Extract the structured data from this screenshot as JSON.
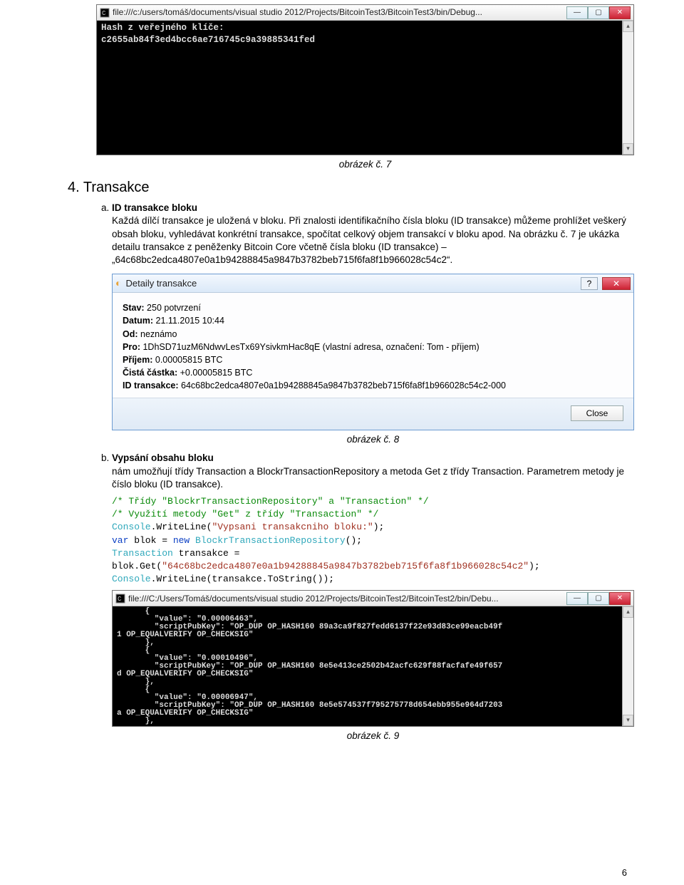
{
  "console1": {
    "path": "file:///c:/users/tomáš/documents/visual studio 2012/Projects/BitcoinTest3/BitcoinTest3/bin/Debug...",
    "line1": "Hash z veřejného klíče:",
    "line2": "c2655ab84f3ed4bcc6ae716745c9a39885341fed"
  },
  "caption7": "obrázek č. 7",
  "section4": {
    "title": "4. Transakce",
    "item_a_title": "ID transakce bloku",
    "item_a_body": "Každá dílčí transakce je uložená v bloku. Při znalosti identifikačního čísla bloku (ID transakce) můžeme prohlížet veškerý obsah bloku, vyhledávat konkrétní transakce, spočítat celkový objem transakcí v bloku apod. Na obrázku č. 7 je ukázka detailu transakce z peněženky Bitcoin Core včetně čísla bloku (ID transakce) – „64c68bc2edca4807e0a1b94288845a9847b3782beb715f6fa8f1b966028c54c2“."
  },
  "dialog": {
    "title": "Detaily transakce",
    "stav_k": "Stav:",
    "stav_v": " 250 potvrzení",
    "datum_k": "Datum:",
    "datum_v": " 21.11.2015 10:44",
    "od_k": "Od:",
    "od_v": " neznámo",
    "pro_k": "Pro:",
    "pro_v": " 1DhSD71uzM6NdwvLesTx69YsivkmHac8qE (vlastní adresa, označení: Tom - příjem)",
    "prijem_k": "Příjem:",
    "prijem_v": " 0.00005815 BTC",
    "cista_k": "Čistá částka:",
    "cista_v": " +0.00005815 BTC",
    "idtx_k": "ID transakce:",
    "idtx_v": " 64c68bc2edca4807e0a1b94288845a9847b3782beb715f6fa8f1b966028c54c2-000",
    "close": "Close"
  },
  "caption8": "obrázek č. 8",
  "item_b": {
    "title": "Vypsání obsahu bloku",
    "body": "nám umožňují třídy Transaction a BlockrTransactionRepository a metoda Get z třídy Transaction. Parametrem metody je číslo bloku (ID transakce)."
  },
  "code": {
    "c1": "/* Třídy \"BlockrTransactionRepository\" a \"Transaction\" */",
    "c2": "/* Využití metody \"Get\" z třídy \"Transaction\" */",
    "l3a": "Console",
    "l3b": ".WriteLine(",
    "l3c": "\"Vypsani transakcniho bloku:\"",
    "l3d": ");",
    "l4a": "var",
    "l4b": " blok = ",
    "l4c": "new",
    "l4d": " ",
    "l4e": "BlockrTransactionRepository",
    "l4f": "();",
    "l5a": "Transaction",
    "l5b": " transakce =",
    "l6a": "blok.Get(",
    "l6b": "\"64c68bc2edca4807e0a1b94288845a9847b3782beb715f6fa8f1b966028c54c2\"",
    "l6c": ");",
    "l7a": "Console",
    "l7b": ".WriteLine(transakce.ToString());"
  },
  "console2": {
    "path": "file:///C:/Users/Tomáš/documents/visual studio 2012/Projects/BitcoinTest2/BitcoinTest2/bin/Debu...",
    "lines": [
      "      {",
      "        \"value\": \"0.00006463\",",
      "        \"scriptPubKey\": \"OP_DUP OP_HASH160 89a3ca9f827fedd6137f22e93d83ce99eacb49f",
      "1 OP_EQUALVERIFY OP_CHECKSIG\"",
      "      },",
      "      {",
      "        \"value\": \"0.00010496\",",
      "        \"scriptPubKey\": \"OP_DUP OP_HASH160 8e5e413ce2502b42acfc629f88facfafe49f657",
      "d OP_EQUALVERIFY OP_CHECKSIG\"",
      "      },",
      "      {",
      "        \"value\": \"0.00006947\",",
      "        \"scriptPubKey\": \"OP_DUP OP_HASH160 8e5e574537f795275778d654ebb955e964d7203",
      "a OP_EQUALVERIFY OP_CHECKSIG\"",
      "      },"
    ]
  },
  "caption9": "obrázek č. 9",
  "page_num": "6"
}
